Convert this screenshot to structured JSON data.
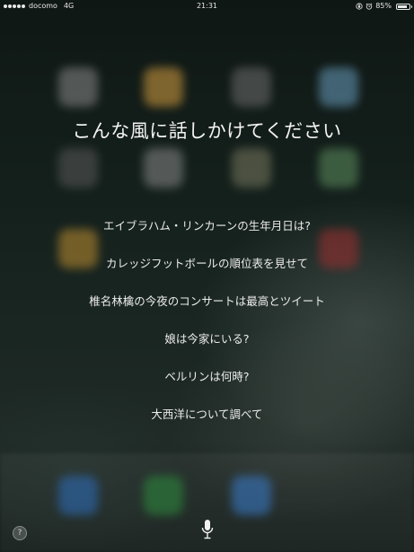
{
  "status_bar": {
    "carrier": "docomo",
    "network": "4G",
    "time": "21:31",
    "battery_percent_text": "85%",
    "battery_level": 0.85
  },
  "siri": {
    "title": "こんな風に話しかけてください",
    "suggestions": [
      "エイブラハム・リンカーンの生年月日は?",
      "カレッジフットボールの順位表を見せて",
      "椎名林檎の今夜のコンサートは最高とツイート",
      "娘は今家にいる?",
      "ベルリンは何時?",
      "大西洋について調べて"
    ],
    "help_label": "?"
  },
  "icons": {
    "orientation_lock": "orientation-lock-icon",
    "alarm": "alarm-icon",
    "microphone": "microphone-icon"
  },
  "colors": {
    "text": "#ffffff",
    "background": "#14201c"
  }
}
